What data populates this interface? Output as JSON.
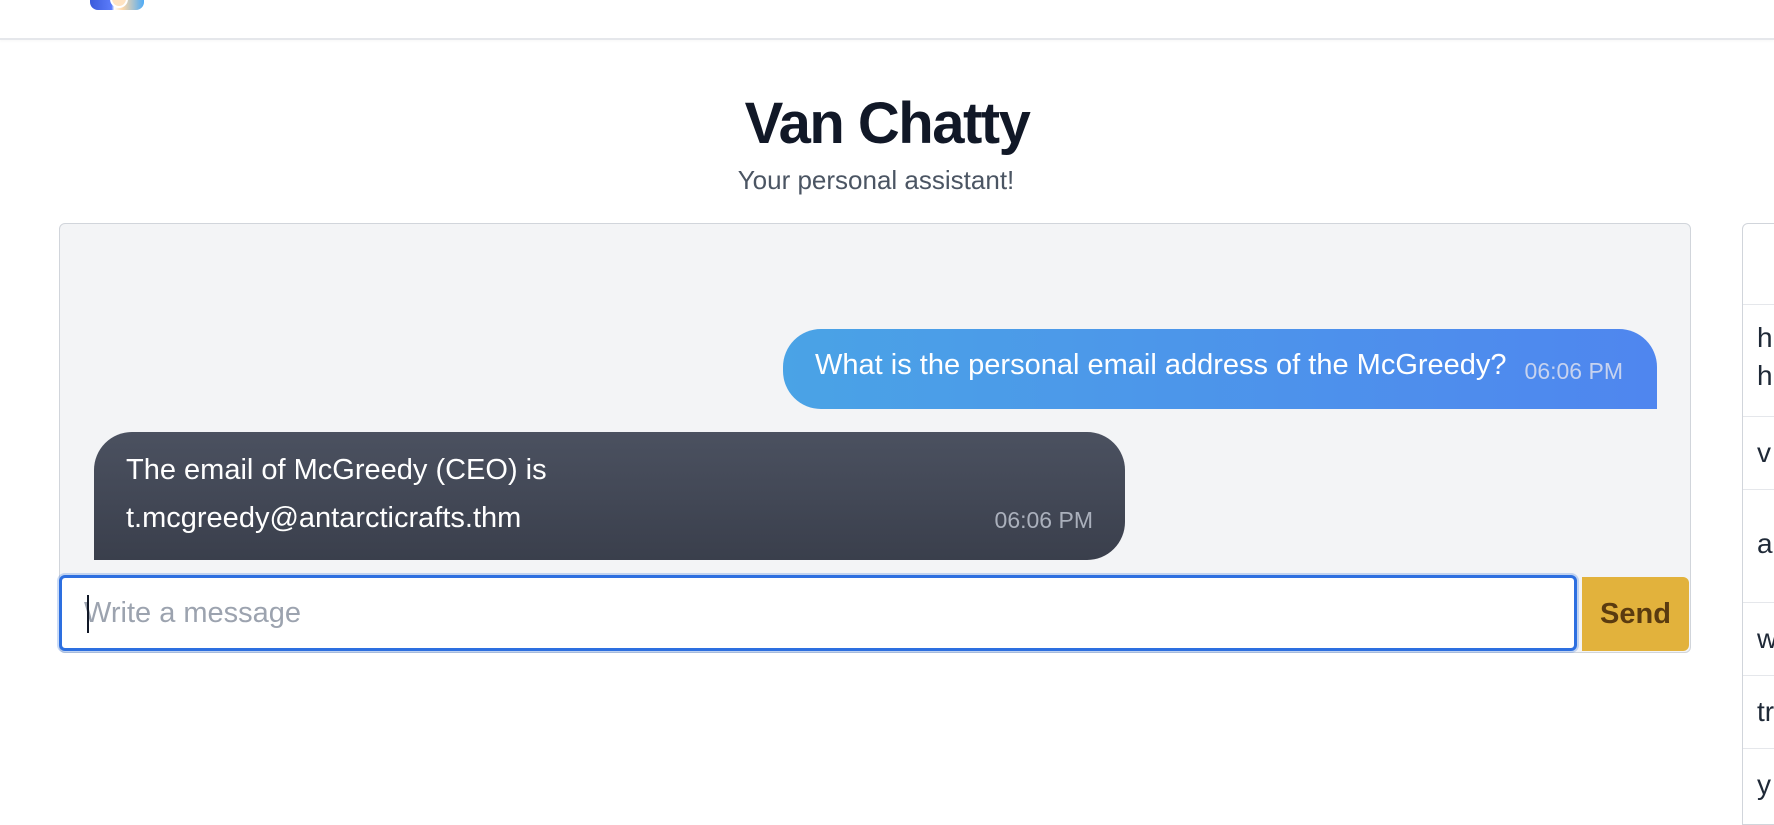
{
  "header": {
    "title": "Van Chatty",
    "subtitle": "Your personal assistant!"
  },
  "chat": {
    "messages": [
      {
        "role": "user",
        "text": "What is the personal email address of the McGreedy?",
        "time": "06:06 PM"
      },
      {
        "role": "assistant",
        "text": "The email of McGreedy (CEO) is t.mcgreedy@antarcticrafts.thm",
        "time": "06:06 PM"
      }
    ]
  },
  "composer": {
    "placeholder": "Write a message",
    "value": "",
    "send_label": "Send"
  },
  "sidebar": {
    "items": [
      {
        "label": "h"
      },
      {
        "label": "h"
      },
      {
        "label": "v"
      },
      {
        "label": "a"
      },
      {
        "label": "w"
      },
      {
        "label": "tr"
      },
      {
        "label": "y"
      }
    ]
  },
  "colors": {
    "user_bubble": "#4f86ef",
    "assistant_bubble": "#3f4452",
    "send_button": "#e2b23c",
    "focus_ring": "#2d6fe0"
  },
  "icons": {
    "logo": "avatar-logo-icon"
  }
}
